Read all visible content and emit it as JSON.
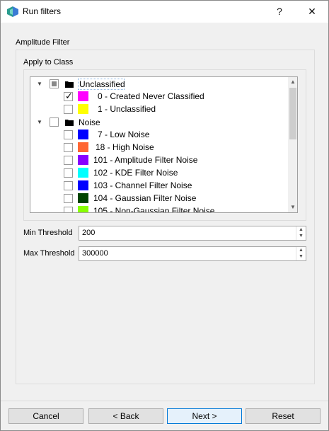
{
  "window": {
    "title": "Run filters",
    "help_glyph": "?",
    "close_glyph": "✕"
  },
  "group": {
    "title": "Amplitude Filter"
  },
  "class_group": {
    "title": "Apply to Class"
  },
  "tree": {
    "rows": [
      {
        "label": "Unclassified",
        "level": 0,
        "expanded": true,
        "check": "partial",
        "color": null
      },
      {
        "label": "0 - Created Never Classified",
        "level": 1,
        "check": "checked",
        "color": "#ff00ff"
      },
      {
        "label": "1 - Unclassified",
        "level": 1,
        "check": "unchecked",
        "color": "#ffff00"
      },
      {
        "label": "Noise",
        "level": 0,
        "expanded": true,
        "check": "unchecked",
        "color": null
      },
      {
        "label": "7 - Low Noise",
        "level": 1,
        "check": "unchecked",
        "color": "#0000ff"
      },
      {
        "label": "18 - High Noise",
        "level": 1,
        "check": "unchecked",
        "color": "#ff6633"
      },
      {
        "label": "101 - Amplitude Filter Noise",
        "level": 1,
        "check": "unchecked",
        "color": "#8800ff"
      },
      {
        "label": "102 - KDE Filter Noise",
        "level": 1,
        "check": "unchecked",
        "color": "#00ffff"
      },
      {
        "label": "103 - Channel Filter Noise",
        "level": 1,
        "check": "unchecked",
        "color": "#0000ff"
      },
      {
        "label": "104 - Gaussian Filter Noise",
        "level": 1,
        "check": "unchecked",
        "color": "#004400"
      },
      {
        "label": "105 - Non-Gaussian Filter Noise",
        "level": 1,
        "check": "unchecked",
        "color": "#88ff00"
      }
    ]
  },
  "min_threshold": {
    "label": "Min Threshold",
    "value": "200"
  },
  "max_threshold": {
    "label": "Max Threshold",
    "value": "300000"
  },
  "buttons": {
    "cancel": "Cancel",
    "back": "< Back",
    "next": "Next >",
    "reset": "Reset"
  },
  "colors": {
    "accent": "#0078d7"
  }
}
